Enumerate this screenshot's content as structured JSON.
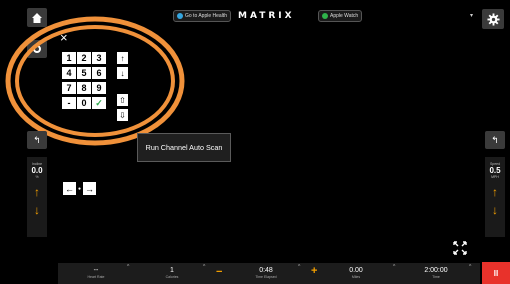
{
  "header": {
    "logo": "MATRIX",
    "badge_left": "Go to Apple Health",
    "badge_right": "Apple Watch",
    "badge_left_color": "#35a6e0",
    "badge_right_color": "#2fb34a"
  },
  "keypad": {
    "close": "×",
    "keys": [
      "1",
      "2",
      "3",
      "4",
      "5",
      "6",
      "7",
      "8",
      "9",
      "-",
      "0",
      "✓"
    ],
    "side_keys": [
      "↑",
      "↓",
      "⇧",
      "⇩"
    ]
  },
  "tooltip": {
    "text": "Run Channel Auto Scan"
  },
  "nav_arrows": {
    "left": "←",
    "right": "→"
  },
  "left_panel": {
    "label_top": "Incline",
    "value": "0.0",
    "label_bottom": "%",
    "up": "↑",
    "down": "↓"
  },
  "right_panel": {
    "label_top": "Speed",
    "value": "0.5",
    "label_bottom": "MPH",
    "up": "↑",
    "down": "↓"
  },
  "back_icon": "↰",
  "stats": [
    {
      "value": "--",
      "label": "Heart Rate"
    },
    {
      "value": "1",
      "label": "Calories"
    },
    {
      "value": "0:48",
      "label": "Time Elapsed"
    },
    {
      "value": "0.00",
      "label": "Miles"
    },
    {
      "value": "2:00:00",
      "label": "Time"
    }
  ],
  "minus": "−",
  "plus": "+",
  "pause": "II",
  "colors": {
    "accent": "#f5a000",
    "pause": "#e8322b",
    "highlight_ring": "#f0913a"
  }
}
